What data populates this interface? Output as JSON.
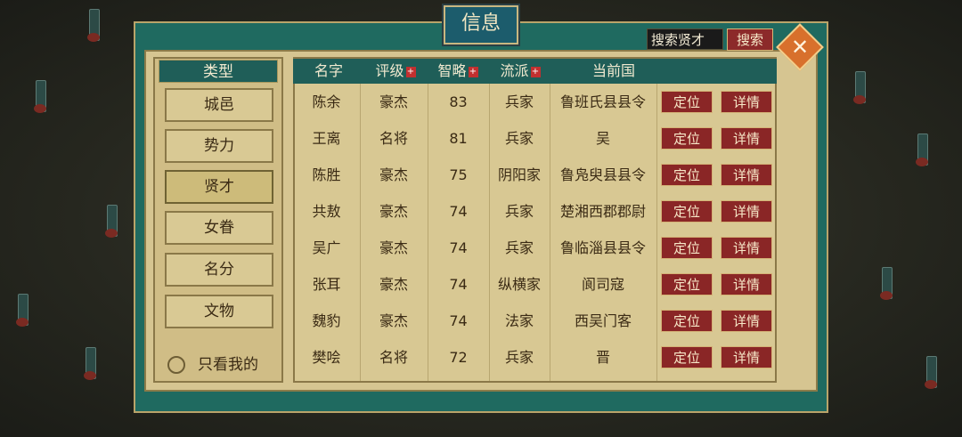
{
  "window": {
    "title": "信息"
  },
  "search": {
    "value": "搜索贤才",
    "button_label": "搜索"
  },
  "close": {
    "label": "✕"
  },
  "categories": {
    "header": "类型",
    "items": [
      {
        "label": "城邑"
      },
      {
        "label": "势力"
      },
      {
        "label": "贤才"
      },
      {
        "label": "女眷"
      },
      {
        "label": "名分"
      },
      {
        "label": "文物"
      }
    ],
    "active_index": 2,
    "only_mine_label": "只看我的"
  },
  "table": {
    "columns": [
      {
        "label": "名字"
      },
      {
        "label": "评级",
        "sortable": true
      },
      {
        "label": "智略",
        "sortable": true
      },
      {
        "label": "流派",
        "sortable": true
      },
      {
        "label": "当前国"
      }
    ],
    "sort_icon": "+",
    "action_labels": {
      "locate": "定位",
      "details": "详情"
    },
    "rows": [
      {
        "name": "陈余",
        "rank": "豪杰",
        "wisdom": "83",
        "school": "兵家",
        "location": "鲁班氏县县令"
      },
      {
        "name": "王离",
        "rank": "名将",
        "wisdom": "81",
        "school": "兵家",
        "location": "吴"
      },
      {
        "name": "陈胜",
        "rank": "豪杰",
        "wisdom": "75",
        "school": "阴阳家",
        "location": "鲁凫臾县县令"
      },
      {
        "name": "共敖",
        "rank": "豪杰",
        "wisdom": "74",
        "school": "兵家",
        "location": "楚湘西郡郡尉"
      },
      {
        "name": "吴广",
        "rank": "豪杰",
        "wisdom": "74",
        "school": "兵家",
        "location": "鲁临淄县县令"
      },
      {
        "name": "张耳",
        "rank": "豪杰",
        "wisdom": "74",
        "school": "纵横家",
        "location": "阆司寇"
      },
      {
        "name": "魏豹",
        "rank": "豪杰",
        "wisdom": "74",
        "school": "法家",
        "location": "西吴门客"
      },
      {
        "name": "樊哙",
        "rank": "名将",
        "wisdom": "72",
        "school": "兵家",
        "location": "晋"
      }
    ]
  },
  "colors": {
    "panel_teal": "#1f6a60",
    "parchment": "#d6c591",
    "button_red": "#8a2626",
    "accent_orange": "#d8702c"
  }
}
